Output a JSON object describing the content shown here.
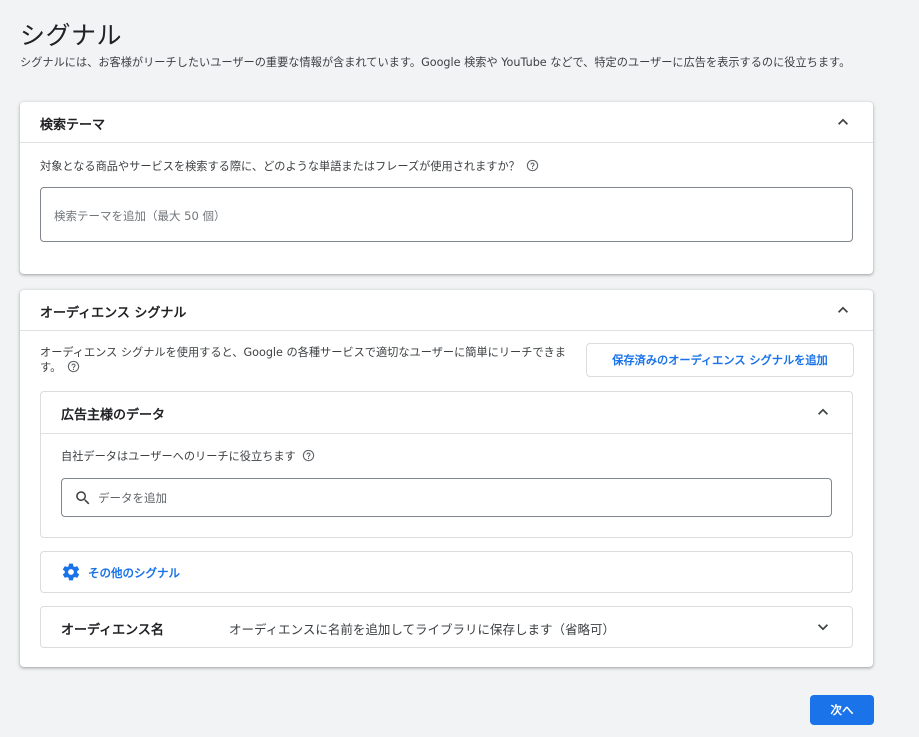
{
  "page": {
    "title": "シグナル",
    "description": "シグナルには、お客様がリーチしたいユーザーの重要な情報が含まれています。Google 検索や YouTube などで、特定のユーザーに広告を表示するのに役立ちます。"
  },
  "search_themes": {
    "title": "検索テーマ",
    "question": "対象となる商品やサービスを検索する際に、どのような単語またはフレーズが使用されますか？",
    "input_placeholder": "検索テーマを追加（最大 50 個）",
    "collapse_icon": "chevron-up-icon",
    "help_icon": "help-circle-icon"
  },
  "audience_signal": {
    "title": "オーディエンス シグナル",
    "description": "オーディエンス シグナルを使用すると、Google の各種サービスで適切なユーザーに簡単にリーチできます。",
    "add_saved_button": "保存済みのオーディエンス シグナルを追加",
    "collapse_icon": "chevron-up-icon",
    "advertiser_data": {
      "title": "広告主様のデータ",
      "description": "自社データはユーザーへのリーチに役立ちます",
      "input_placeholder": "データを追加",
      "search_icon": "search-icon"
    },
    "other_signals": {
      "label": "その他のシグナル",
      "icon": "gear-icon"
    },
    "audience_name": {
      "label": "オーディエンス名",
      "hint": "オーディエンスに名前を追加してライブラリに保存します（省略可）",
      "expand_icon": "chevron-down-icon"
    }
  },
  "footer": {
    "next_button": "次へ"
  },
  "colors": {
    "accent": "#1a73e8",
    "background": "#f1f3f4",
    "card": "#ffffff",
    "text": "#202124"
  }
}
